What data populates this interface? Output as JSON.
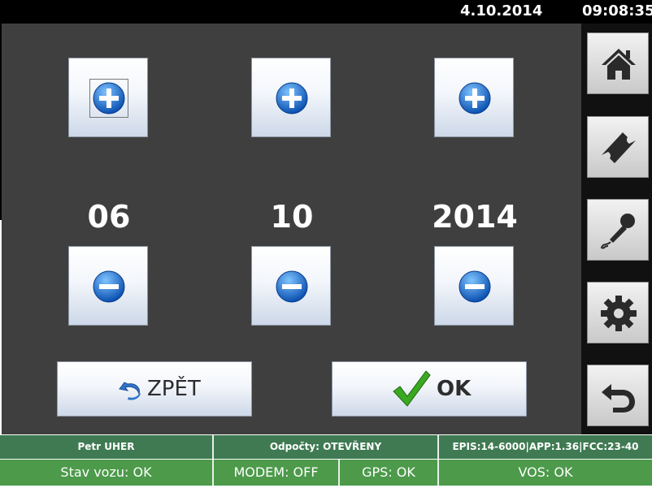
{
  "header": {
    "date": "4.10.2014",
    "time": "09:08:35"
  },
  "date_picker": {
    "day": "06",
    "month": "10",
    "year": "2014"
  },
  "buttons": {
    "back_label": "ZPĚT",
    "ok_label": "OK"
  },
  "sidebar": {
    "items": [
      {
        "icon": "home-icon"
      },
      {
        "icon": "ticket-icon"
      },
      {
        "icon": "microphone-icon"
      },
      {
        "icon": "gear-icon"
      },
      {
        "icon": "return-arrow-icon"
      }
    ]
  },
  "status": {
    "driver": "Petr UHER",
    "counts": "Odpočty: OTEVŘENY",
    "versions": "EPIS:14-6000|APP:1.36|FCC:23-40",
    "vehicle": "Stav vozu: OK",
    "modem": "MODEM:  OFF",
    "gps": "GPS:  OK",
    "vos": "VOS:  OK"
  },
  "colors": {
    "accent_blue": "#1a6fd0",
    "ok_green": "#3aa820",
    "status_dark": "#3f7a52",
    "status_light": "#4c9a4a"
  }
}
